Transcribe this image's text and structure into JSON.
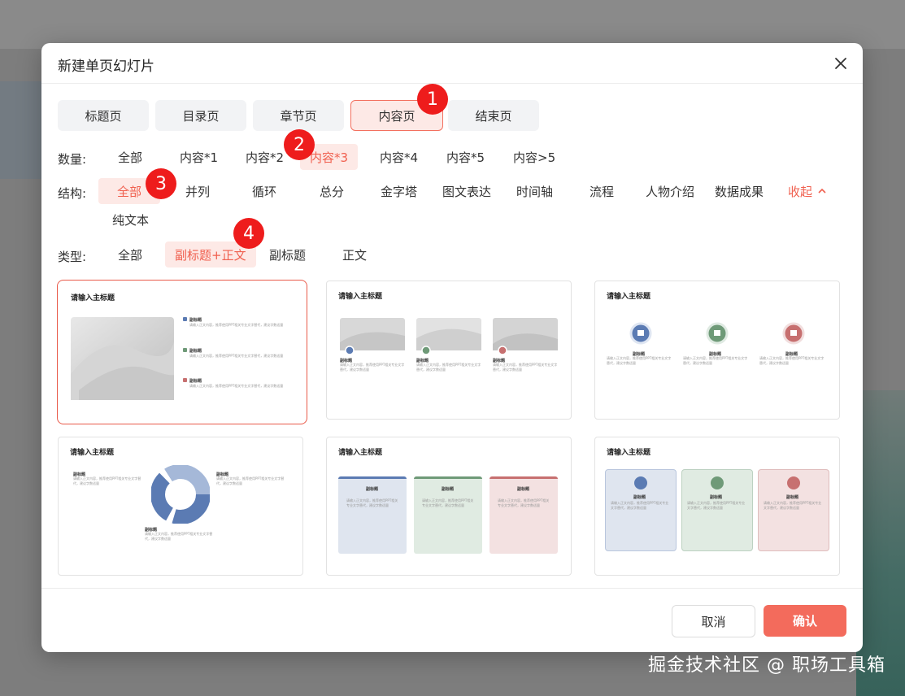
{
  "dialog": {
    "title": "新建单页幻灯片"
  },
  "tabs": [
    "标题页",
    "目录页",
    "章节页",
    "内容页",
    "结束页"
  ],
  "quantity": {
    "label": "数量:",
    "options": [
      "全部",
      "内容*1",
      "内容*2",
      "内容*3",
      "内容*4",
      "内容*5",
      "内容>5"
    ]
  },
  "structure": {
    "label": "结构:",
    "options": [
      "全部",
      "并列",
      "循环",
      "总分",
      "金字塔",
      "图文表达",
      "时间轴",
      "流程",
      "人物介绍",
      "数据成果",
      "纯文本"
    ],
    "collapse": "收起"
  },
  "type": {
    "label": "类型:",
    "options": [
      "全部",
      "副标题+正文",
      "副标题",
      "正文"
    ]
  },
  "badges": [
    "1",
    "2",
    "3",
    "4"
  ],
  "cards": [
    {
      "title": "请输入主标题",
      "sub": "副标题",
      "body": "请输入正文内容，推荐使用PPT相关专业文字替代，建议字数适量"
    },
    {
      "title": "请输入主标题",
      "sub": "副标题",
      "body": "请输入正文内容，推荐使用PPT相关专业文字替代，建议字数适量"
    },
    {
      "title": "请输入主标题",
      "sub": "副标题",
      "body": "请输入正文内容，推荐使用PPT相关专业文字替代，建议字数适量"
    },
    {
      "title": "请输入主标题",
      "sub": "副标题",
      "body": "请输入正文内容，推荐使用PPT相关专业文字替代，建议字数适量"
    },
    {
      "title": "请输入主标题",
      "sub": "副标题",
      "body": "请输入正文内容，推荐使用PPT相关专业文字替代，建议字数适量"
    },
    {
      "title": "请输入主标题",
      "sub": "副标题",
      "body": "请输入正文内容，推荐使用PPT相关专业文字替代，建议字数适量"
    }
  ],
  "footer": {
    "cancel": "取消",
    "confirm": "确认"
  },
  "watermark": "掘金技术社区 @ 职场工具箱",
  "colors": {
    "accent": "#f36b5c",
    "blue": "#5b7bb3",
    "green": "#6f9a78",
    "red": "#c77070"
  }
}
